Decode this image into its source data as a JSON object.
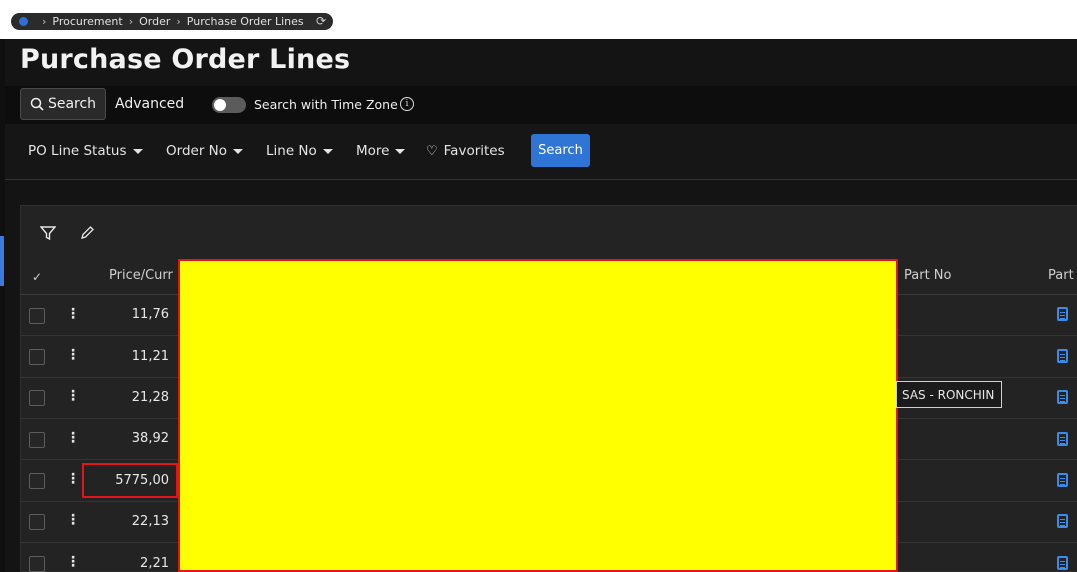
{
  "breadcrumb": {
    "items": [
      "Procurement",
      "Order",
      "Purchase Order Lines"
    ]
  },
  "page_title": "Purchase Order Lines",
  "search_tabs": {
    "search_label": "Search",
    "advanced_label": "Advanced",
    "timezone_label": "Search with Time Zone",
    "timezone_enabled": false
  },
  "filters": {
    "items": [
      "PO Line Status",
      "Order No",
      "Line No",
      "More"
    ],
    "favorites_label": "Favorites",
    "search_button": "Search"
  },
  "table": {
    "columns": [
      "Price/Curr",
      "Part No",
      "Part"
    ],
    "rows": [
      {
        "price": "11,76"
      },
      {
        "price": "11,21"
      },
      {
        "price": "21,28"
      },
      {
        "price": "38,92"
      },
      {
        "price": "5775,00"
      },
      {
        "price": "22,13"
      },
      {
        "price": "2,21"
      }
    ],
    "tooltip": "SAS - RONCHIN"
  },
  "colors": {
    "accent": "#2e75d6",
    "highlight": "#e0161b",
    "redaction": "#ffff00"
  }
}
